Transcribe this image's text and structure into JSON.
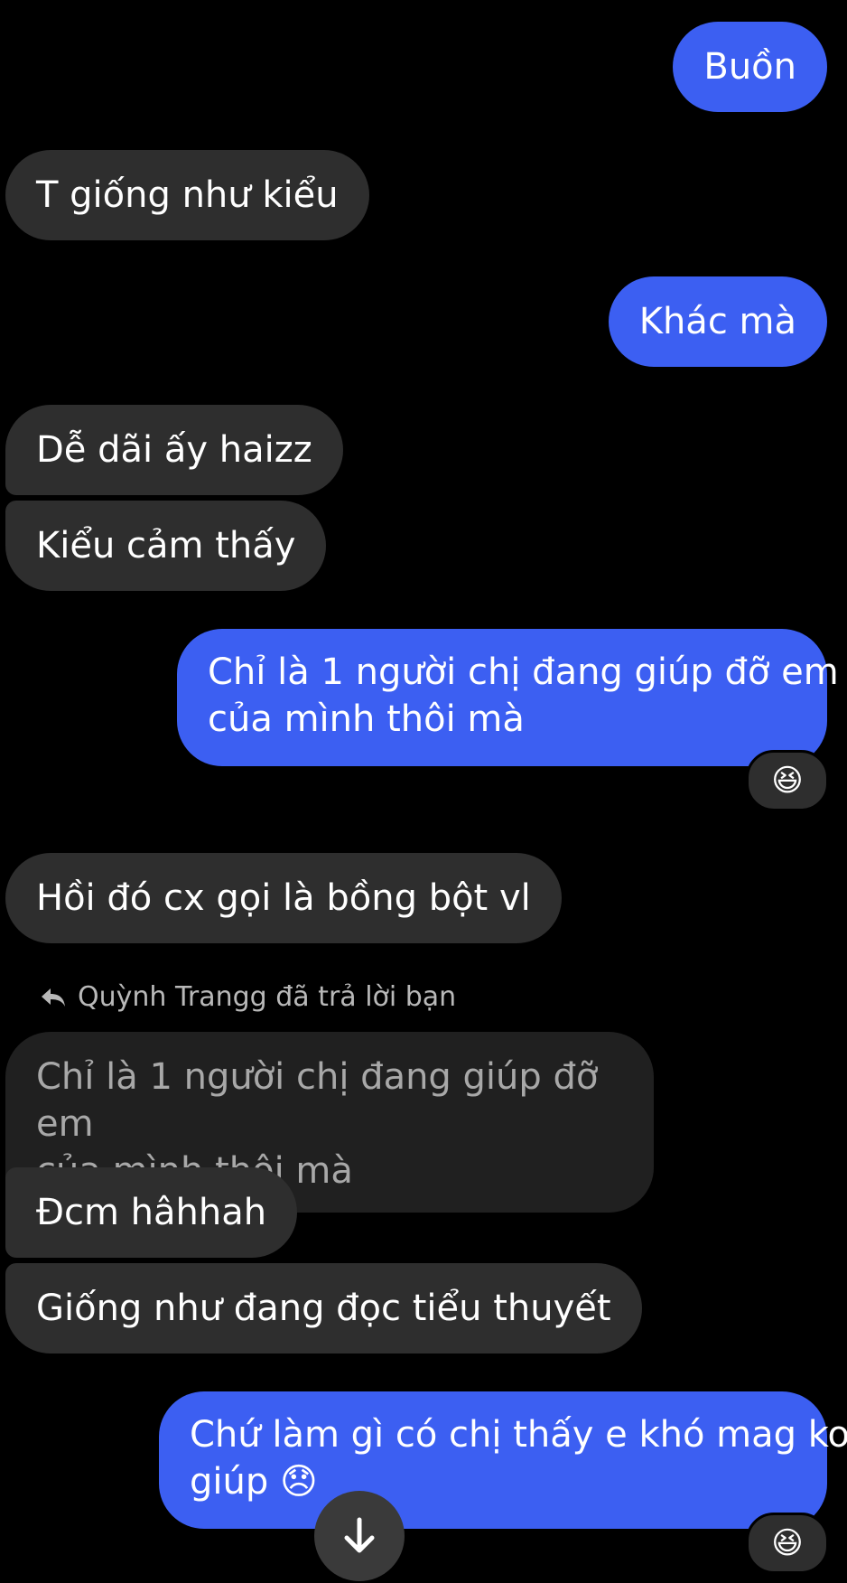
{
  "conversation": {
    "messages": [
      {
        "id": "m1",
        "sender": "me",
        "text": "Buồn"
      },
      {
        "id": "m2",
        "sender": "other",
        "text": "T giống như kiểu"
      },
      {
        "id": "m3",
        "sender": "me",
        "text": "Khác mà"
      },
      {
        "id": "m4",
        "sender": "other",
        "text": "Dễ dãi ấy haizz"
      },
      {
        "id": "m5",
        "sender": "other",
        "text": "Kiểu cảm thấy"
      },
      {
        "id": "m6",
        "sender": "me",
        "line1": "Chỉ là 1 người chị đang giúp đỡ em",
        "line2": "của mình thôi mà",
        "reaction": "😆"
      },
      {
        "id": "m7",
        "sender": "other",
        "text": "Hồi đó cx gọi là bồng bột vl"
      },
      {
        "id": "m8",
        "sender": "other",
        "reply_label": "Quỳnh Trangg đã trả lời bạn",
        "quoted_line1": "Chỉ là 1 người chị đang giúp đỡ em",
        "quoted_line2": "của mình thôi mà",
        "text": "Đcm hâhhah"
      },
      {
        "id": "m9",
        "sender": "other",
        "text": "Giống như đang đọc tiểu thuyết"
      },
      {
        "id": "m10",
        "sender": "me",
        "line1": "Chứ làm gì có chị thấy e khó mag ko",
        "line2_text": "giúp",
        "line2_emoji": "😞",
        "reaction": "😆"
      }
    ]
  },
  "controls": {
    "scroll_down_icon": "arrow-down-icon",
    "reply_icon": "reply-arrow-icon"
  },
  "colors": {
    "background": "#000000",
    "incoming_bubble": "#2e2e2e",
    "outgoing_bubble": "#3c5ff2",
    "quoted_bubble": "#202020"
  }
}
